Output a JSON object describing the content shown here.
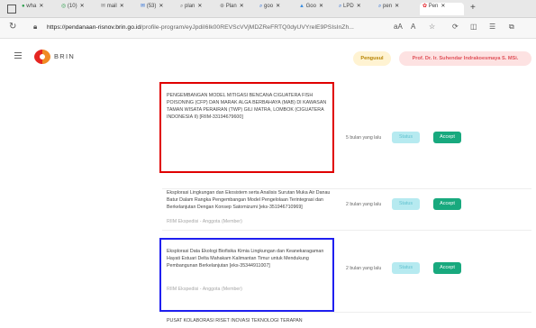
{
  "browser": {
    "tabs": [
      "wha",
      "(10)",
      "mail",
      "(53)",
      "plan",
      "Plan",
      "goo",
      "Goo",
      "LPD",
      "pen",
      "Pen"
    ],
    "url_host": "https://pendanaan-risnov.brin.go.id",
    "url_path": "/profile-program/eyJpdiI6Ik00REVScVVjMDZReFRTQ0dyUVYrelE9PSIsInZh...",
    "reader_label": "aA"
  },
  "app": {
    "logo_text": "BRIN",
    "role_badge": "Pengusul",
    "user_name": "Prof. Dr. Ir. Suhendar Indrakoesmaya S. MSi.",
    "colors": {
      "accept": "#18a97e",
      "status": "#b6eaf0",
      "highlight_red": "#e00000",
      "highlight_blue": "#1f1ff0"
    }
  },
  "programs": [
    {
      "title": "PENGEMBANGAN MODEL MITIGASI BENCANA CIGUATERA FISH POISONING (CFP) DAN MARAK ALGA BERBAHAYA (MAB) DI KAWASAN TAMAN WISATA PERAIRAN (TWP) GILI MATRA, LOMBOK (CIGUATERA INDONESIA II) [RIIM-33194679600]",
      "role": "",
      "time_ago": "5 bulan yang lalu",
      "status_label": "Status",
      "accept_label": "Accept",
      "highlight": "red"
    },
    {
      "title": "Eksplorasi Lingkungan dan Ekosistem serta Analisis Surutan Muka Air Danau Batur Dalam Rangka Pengembangan Model Pengelolaan Terintegrasi dan Berkelanjutan Dengan Konsep Satomizumi [eks-351946710969]",
      "role": "RIIM Ekspedisi - Anggota (Member)",
      "time_ago": "2 bulan yang lalu",
      "status_label": "Status",
      "accept_label": "Accept",
      "highlight": ""
    },
    {
      "title": "Eksplorasi Data Ekologi Biofisika Kimia Lingkungan dan Keanekaragaman Hayati Estuari Delta Mahakam Kalimantan Timur untuk Mendukung Pembangunan Berkelanjutan [eks-35344911007]",
      "role": "RIIM Ekspedisi - Anggota (Member)",
      "time_ago": "2 bulan yang lalu",
      "status_label": "Status",
      "accept_label": "Accept",
      "highlight": "blue"
    },
    {
      "title": "PUSAT KOLABORASI RISET INOVASI TEKNOLOGI TERAPAN",
      "role": "",
      "time_ago": "",
      "status_label": "",
      "accept_label": "",
      "highlight": ""
    }
  ]
}
